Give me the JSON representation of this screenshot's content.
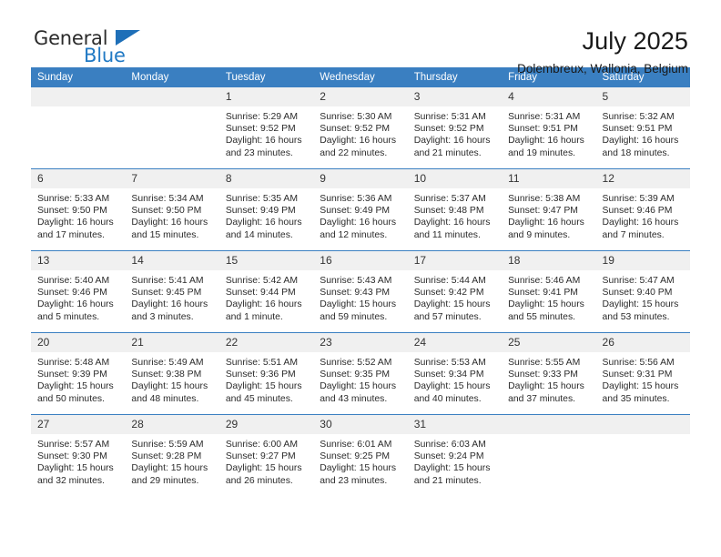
{
  "brand": {
    "name_top": "General",
    "name_bottom": "Blue",
    "accent_color": "#2079c4",
    "triangle_color": "#1e6fb8"
  },
  "header": {
    "title": "July 2025",
    "subtitle": "Dolembreux, Wallonia, Belgium"
  },
  "calendar": {
    "header_bg": "#3a7fc1",
    "daynum_bg": "#f0f0f0",
    "weekday_headers": [
      "Sunday",
      "Monday",
      "Tuesday",
      "Wednesday",
      "Thursday",
      "Friday",
      "Saturday"
    ],
    "weeks": [
      [
        {
          "day": "",
          "blank": true,
          "sunrise": "",
          "sunset": "",
          "daylight_line1": "",
          "daylight_line2": ""
        },
        {
          "day": "",
          "blank": true,
          "sunrise": "",
          "sunset": "",
          "daylight_line1": "",
          "daylight_line2": ""
        },
        {
          "day": "1",
          "sunrise": "Sunrise: 5:29 AM",
          "sunset": "Sunset: 9:52 PM",
          "daylight_line1": "Daylight: 16 hours",
          "daylight_line2": "and 23 minutes."
        },
        {
          "day": "2",
          "sunrise": "Sunrise: 5:30 AM",
          "sunset": "Sunset: 9:52 PM",
          "daylight_line1": "Daylight: 16 hours",
          "daylight_line2": "and 22 minutes."
        },
        {
          "day": "3",
          "sunrise": "Sunrise: 5:31 AM",
          "sunset": "Sunset: 9:52 PM",
          "daylight_line1": "Daylight: 16 hours",
          "daylight_line2": "and 21 minutes."
        },
        {
          "day": "4",
          "sunrise": "Sunrise: 5:31 AM",
          "sunset": "Sunset: 9:51 PM",
          "daylight_line1": "Daylight: 16 hours",
          "daylight_line2": "and 19 minutes."
        },
        {
          "day": "5",
          "sunrise": "Sunrise: 5:32 AM",
          "sunset": "Sunset: 9:51 PM",
          "daylight_line1": "Daylight: 16 hours",
          "daylight_line2": "and 18 minutes."
        }
      ],
      [
        {
          "day": "6",
          "sunrise": "Sunrise: 5:33 AM",
          "sunset": "Sunset: 9:50 PM",
          "daylight_line1": "Daylight: 16 hours",
          "daylight_line2": "and 17 minutes."
        },
        {
          "day": "7",
          "sunrise": "Sunrise: 5:34 AM",
          "sunset": "Sunset: 9:50 PM",
          "daylight_line1": "Daylight: 16 hours",
          "daylight_line2": "and 15 minutes."
        },
        {
          "day": "8",
          "sunrise": "Sunrise: 5:35 AM",
          "sunset": "Sunset: 9:49 PM",
          "daylight_line1": "Daylight: 16 hours",
          "daylight_line2": "and 14 minutes."
        },
        {
          "day": "9",
          "sunrise": "Sunrise: 5:36 AM",
          "sunset": "Sunset: 9:49 PM",
          "daylight_line1": "Daylight: 16 hours",
          "daylight_line2": "and 12 minutes."
        },
        {
          "day": "10",
          "sunrise": "Sunrise: 5:37 AM",
          "sunset": "Sunset: 9:48 PM",
          "daylight_line1": "Daylight: 16 hours",
          "daylight_line2": "and 11 minutes."
        },
        {
          "day": "11",
          "sunrise": "Sunrise: 5:38 AM",
          "sunset": "Sunset: 9:47 PM",
          "daylight_line1": "Daylight: 16 hours",
          "daylight_line2": "and 9 minutes."
        },
        {
          "day": "12",
          "sunrise": "Sunrise: 5:39 AM",
          "sunset": "Sunset: 9:46 PM",
          "daylight_line1": "Daylight: 16 hours",
          "daylight_line2": "and 7 minutes."
        }
      ],
      [
        {
          "day": "13",
          "sunrise": "Sunrise: 5:40 AM",
          "sunset": "Sunset: 9:46 PM",
          "daylight_line1": "Daylight: 16 hours",
          "daylight_line2": "and 5 minutes."
        },
        {
          "day": "14",
          "sunrise": "Sunrise: 5:41 AM",
          "sunset": "Sunset: 9:45 PM",
          "daylight_line1": "Daylight: 16 hours",
          "daylight_line2": "and 3 minutes."
        },
        {
          "day": "15",
          "sunrise": "Sunrise: 5:42 AM",
          "sunset": "Sunset: 9:44 PM",
          "daylight_line1": "Daylight: 16 hours",
          "daylight_line2": "and 1 minute."
        },
        {
          "day": "16",
          "sunrise": "Sunrise: 5:43 AM",
          "sunset": "Sunset: 9:43 PM",
          "daylight_line1": "Daylight: 15 hours",
          "daylight_line2": "and 59 minutes."
        },
        {
          "day": "17",
          "sunrise": "Sunrise: 5:44 AM",
          "sunset": "Sunset: 9:42 PM",
          "daylight_line1": "Daylight: 15 hours",
          "daylight_line2": "and 57 minutes."
        },
        {
          "day": "18",
          "sunrise": "Sunrise: 5:46 AM",
          "sunset": "Sunset: 9:41 PM",
          "daylight_line1": "Daylight: 15 hours",
          "daylight_line2": "and 55 minutes."
        },
        {
          "day": "19",
          "sunrise": "Sunrise: 5:47 AM",
          "sunset": "Sunset: 9:40 PM",
          "daylight_line1": "Daylight: 15 hours",
          "daylight_line2": "and 53 minutes."
        }
      ],
      [
        {
          "day": "20",
          "sunrise": "Sunrise: 5:48 AM",
          "sunset": "Sunset: 9:39 PM",
          "daylight_line1": "Daylight: 15 hours",
          "daylight_line2": "and 50 minutes."
        },
        {
          "day": "21",
          "sunrise": "Sunrise: 5:49 AM",
          "sunset": "Sunset: 9:38 PM",
          "daylight_line1": "Daylight: 15 hours",
          "daylight_line2": "and 48 minutes."
        },
        {
          "day": "22",
          "sunrise": "Sunrise: 5:51 AM",
          "sunset": "Sunset: 9:36 PM",
          "daylight_line1": "Daylight: 15 hours",
          "daylight_line2": "and 45 minutes."
        },
        {
          "day": "23",
          "sunrise": "Sunrise: 5:52 AM",
          "sunset": "Sunset: 9:35 PM",
          "daylight_line1": "Daylight: 15 hours",
          "daylight_line2": "and 43 minutes."
        },
        {
          "day": "24",
          "sunrise": "Sunrise: 5:53 AM",
          "sunset": "Sunset: 9:34 PM",
          "daylight_line1": "Daylight: 15 hours",
          "daylight_line2": "and 40 minutes."
        },
        {
          "day": "25",
          "sunrise": "Sunrise: 5:55 AM",
          "sunset": "Sunset: 9:33 PM",
          "daylight_line1": "Daylight: 15 hours",
          "daylight_line2": "and 37 minutes."
        },
        {
          "day": "26",
          "sunrise": "Sunrise: 5:56 AM",
          "sunset": "Sunset: 9:31 PM",
          "daylight_line1": "Daylight: 15 hours",
          "daylight_line2": "and 35 minutes."
        }
      ],
      [
        {
          "day": "27",
          "sunrise": "Sunrise: 5:57 AM",
          "sunset": "Sunset: 9:30 PM",
          "daylight_line1": "Daylight: 15 hours",
          "daylight_line2": "and 32 minutes."
        },
        {
          "day": "28",
          "sunrise": "Sunrise: 5:59 AM",
          "sunset": "Sunset: 9:28 PM",
          "daylight_line1": "Daylight: 15 hours",
          "daylight_line2": "and 29 minutes."
        },
        {
          "day": "29",
          "sunrise": "Sunrise: 6:00 AM",
          "sunset": "Sunset: 9:27 PM",
          "daylight_line1": "Daylight: 15 hours",
          "daylight_line2": "and 26 minutes."
        },
        {
          "day": "30",
          "sunrise": "Sunrise: 6:01 AM",
          "sunset": "Sunset: 9:25 PM",
          "daylight_line1": "Daylight: 15 hours",
          "daylight_line2": "and 23 minutes."
        },
        {
          "day": "31",
          "sunrise": "Sunrise: 6:03 AM",
          "sunset": "Sunset: 9:24 PM",
          "daylight_line1": "Daylight: 15 hours",
          "daylight_line2": "and 21 minutes."
        },
        {
          "day": "",
          "blank": true,
          "sunrise": "",
          "sunset": "",
          "daylight_line1": "",
          "daylight_line2": ""
        },
        {
          "day": "",
          "blank": true,
          "sunrise": "",
          "sunset": "",
          "daylight_line1": "",
          "daylight_line2": ""
        }
      ]
    ]
  }
}
